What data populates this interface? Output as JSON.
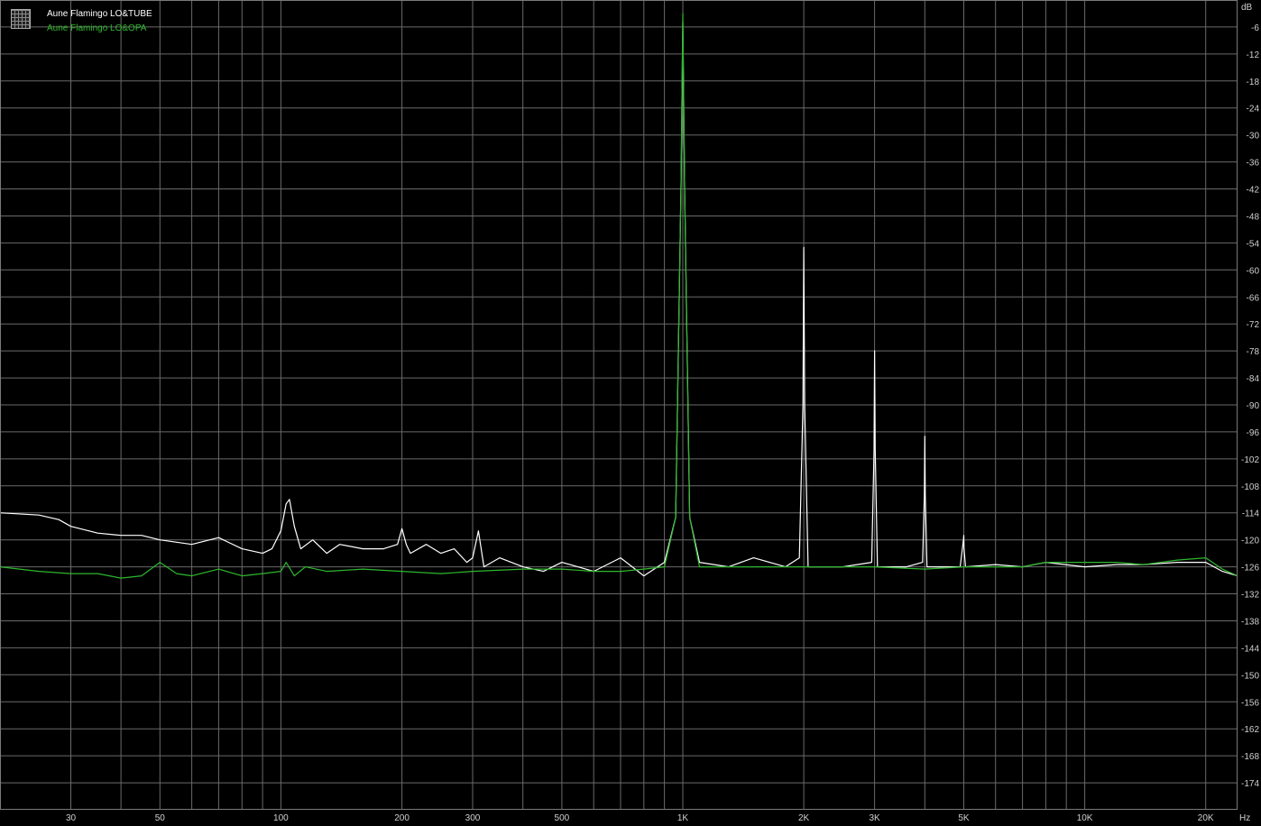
{
  "chart_data": {
    "type": "line",
    "title": "",
    "xlabel": "",
    "ylabel": "",
    "x_unit_label": "Hz",
    "y_unit_label": "dB",
    "x_scale": "log",
    "xlim": [
      20,
      24000
    ],
    "ylim": [
      -180,
      0
    ],
    "grid": true,
    "legend_placement": "top-left",
    "x_tick_labels": [
      {
        "value": 30,
        "label": "30"
      },
      {
        "value": 50,
        "label": "50"
      },
      {
        "value": 100,
        "label": "100"
      },
      {
        "value": 200,
        "label": "200"
      },
      {
        "value": 300,
        "label": "300"
      },
      {
        "value": 500,
        "label": "500"
      },
      {
        "value": 1000,
        "label": "1K"
      },
      {
        "value": 2000,
        "label": "2K"
      },
      {
        "value": 3000,
        "label": "3K"
      },
      {
        "value": 5000,
        "label": "5K"
      },
      {
        "value": 10000,
        "label": "10K"
      },
      {
        "value": 20000,
        "label": "20K"
      }
    ],
    "y_tick_labels": [
      "-6",
      "-12",
      "-18",
      "-24",
      "-30",
      "-36",
      "-42",
      "-48",
      "-54",
      "-60",
      "-66",
      "-72",
      "-78",
      "-84",
      "-90",
      "-96",
      "-102",
      "-108",
      "-114",
      "-120",
      "-126",
      "-132",
      "-138",
      "-144",
      "-150",
      "-156",
      "-162",
      "-168",
      "-174"
    ],
    "series": [
      {
        "name": "Aune Flamingo LO&TUBE",
        "color": "#ffffff",
        "points": [
          [
            20,
            -114
          ],
          [
            25,
            -114.5
          ],
          [
            28,
            -115.5
          ],
          [
            30,
            -117
          ],
          [
            35,
            -118.5
          ],
          [
            40,
            -119
          ],
          [
            45,
            -119
          ],
          [
            50,
            -120
          ],
          [
            60,
            -121
          ],
          [
            70,
            -119.5
          ],
          [
            80,
            -122
          ],
          [
            90,
            -123
          ],
          [
            95,
            -122
          ],
          [
            100,
            -118
          ],
          [
            103,
            -112
          ],
          [
            105,
            -111
          ],
          [
            108,
            -117
          ],
          [
            112,
            -122
          ],
          [
            120,
            -120
          ],
          [
            130,
            -123
          ],
          [
            140,
            -121
          ],
          [
            160,
            -122
          ],
          [
            180,
            -122
          ],
          [
            195,
            -121
          ],
          [
            200,
            -117.5
          ],
          [
            205,
            -121
          ],
          [
            210,
            -123
          ],
          [
            230,
            -121
          ],
          [
            250,
            -123
          ],
          [
            270,
            -122
          ],
          [
            290,
            -125
          ],
          [
            300,
            -124
          ],
          [
            310,
            -118
          ],
          [
            320,
            -126
          ],
          [
            350,
            -124
          ],
          [
            400,
            -126
          ],
          [
            450,
            -127
          ],
          [
            500,
            -125
          ],
          [
            600,
            -127
          ],
          [
            700,
            -124
          ],
          [
            800,
            -128
          ],
          [
            900,
            -125
          ],
          [
            960,
            -115
          ],
          [
            990,
            -40
          ],
          [
            1000,
            -5
          ],
          [
            1010,
            -40
          ],
          [
            1040,
            -115
          ],
          [
            1100,
            -125
          ],
          [
            1300,
            -126
          ],
          [
            1500,
            -124
          ],
          [
            1800,
            -126
          ],
          [
            1950,
            -124
          ],
          [
            1990,
            -90
          ],
          [
            2000,
            -55
          ],
          [
            2010,
            -90
          ],
          [
            2050,
            -126
          ],
          [
            2500,
            -126
          ],
          [
            2950,
            -125
          ],
          [
            2990,
            -100
          ],
          [
            3000,
            -78
          ],
          [
            3010,
            -100
          ],
          [
            3050,
            -126
          ],
          [
            3600,
            -126
          ],
          [
            3950,
            -125
          ],
          [
            3990,
            -110
          ],
          [
            4000,
            -97
          ],
          [
            4010,
            -110
          ],
          [
            4050,
            -126
          ],
          [
            4900,
            -126
          ],
          [
            4990,
            -120
          ],
          [
            5000,
            -119
          ],
          [
            5010,
            -122
          ],
          [
            5050,
            -126
          ],
          [
            6000,
            -125.5
          ],
          [
            7000,
            -126
          ],
          [
            8000,
            -125
          ],
          [
            10000,
            -126
          ],
          [
            12000,
            -125.5
          ],
          [
            14000,
            -125.5
          ],
          [
            17000,
            -125
          ],
          [
            20000,
            -125
          ],
          [
            22000,
            -127
          ],
          [
            24000,
            -128
          ]
        ]
      },
      {
        "name": "Aune Flamingo LO&OPA",
        "color": "#2db82d",
        "points": [
          [
            20,
            -126
          ],
          [
            25,
            -127
          ],
          [
            30,
            -127.5
          ],
          [
            35,
            -127.5
          ],
          [
            40,
            -128.5
          ],
          [
            45,
            -128
          ],
          [
            50,
            -125
          ],
          [
            55,
            -127.5
          ],
          [
            60,
            -128
          ],
          [
            70,
            -126.5
          ],
          [
            80,
            -128
          ],
          [
            90,
            -127.5
          ],
          [
            100,
            -127
          ],
          [
            103,
            -125
          ],
          [
            108,
            -128
          ],
          [
            115,
            -126
          ],
          [
            130,
            -127
          ],
          [
            160,
            -126.5
          ],
          [
            200,
            -127
          ],
          [
            250,
            -127.5
          ],
          [
            300,
            -127
          ],
          [
            400,
            -126.5
          ],
          [
            500,
            -126.5
          ],
          [
            600,
            -127
          ],
          [
            700,
            -127
          ],
          [
            800,
            -126.5
          ],
          [
            900,
            -126
          ],
          [
            960,
            -115
          ],
          [
            990,
            -40
          ],
          [
            1000,
            -3
          ],
          [
            1010,
            -40
          ],
          [
            1040,
            -115
          ],
          [
            1100,
            -126
          ],
          [
            1500,
            -126
          ],
          [
            2000,
            -126
          ],
          [
            2500,
            -126
          ],
          [
            3000,
            -126
          ],
          [
            4000,
            -126.5
          ],
          [
            5000,
            -126
          ],
          [
            6000,
            -126
          ],
          [
            7000,
            -126
          ],
          [
            8000,
            -125
          ],
          [
            10000,
            -125
          ],
          [
            12000,
            -125
          ],
          [
            14000,
            -125.5
          ],
          [
            17000,
            -124.5
          ],
          [
            20000,
            -124
          ],
          [
            22000,
            -126.5
          ],
          [
            24000,
            -128
          ]
        ]
      }
    ]
  }
}
